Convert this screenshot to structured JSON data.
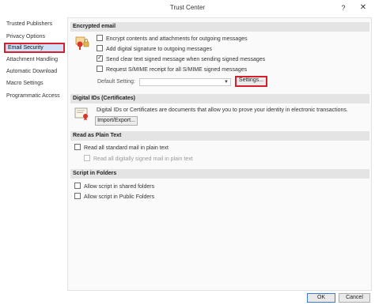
{
  "window": {
    "title": "Trust Center",
    "help_label": "?",
    "close_label": "✕"
  },
  "sidebar": {
    "items": [
      {
        "label": "Trusted Publishers"
      },
      {
        "label": "Privacy Options"
      },
      {
        "label": "Email Security",
        "selected": true
      },
      {
        "label": "Attachment Handling"
      },
      {
        "label": "Automatic Download"
      },
      {
        "label": "Macro Settings"
      },
      {
        "label": "Programmatic Access"
      }
    ]
  },
  "encrypted_email": {
    "header": "Encrypted email",
    "options": [
      {
        "label": "Encrypt contents and attachments for outgoing messages",
        "checked": false
      },
      {
        "label": "Add digital signature to outgoing messages",
        "checked": false
      },
      {
        "label": "Send clear text signed message when sending signed messages",
        "checked": true
      },
      {
        "label": "Request S/MIME receipt for all S/MIME signed messages",
        "checked": false
      }
    ],
    "default_setting_label": "Default Setting:",
    "default_setting_value": "",
    "settings_button": "Settings..."
  },
  "digital_ids": {
    "header": "Digital IDs (Certificates)",
    "description": "Digital IDs or Certificates are documents that allow you to prove your identity in electronic transactions.",
    "import_export_button": "Import/Export..."
  },
  "read_plain": {
    "header": "Read as Plain Text",
    "options": [
      {
        "label": "Read all standard mail in plain text",
        "checked": false,
        "disabled": false
      },
      {
        "label": "Read all digitally signed mail in plain text",
        "checked": false,
        "disabled": true
      }
    ]
  },
  "script_folders": {
    "header": "Script in Folders",
    "options": [
      {
        "label": "Allow script in shared folders",
        "checked": false
      },
      {
        "label": "Allow script in Public Folders",
        "checked": false
      }
    ]
  },
  "footer": {
    "ok_label": "OK",
    "cancel_label": "Cancel"
  },
  "colors": {
    "highlight_border": "#d61f2c",
    "selection_bg": "#cfe2f7",
    "section_header_bg": "#e4e4e4"
  }
}
